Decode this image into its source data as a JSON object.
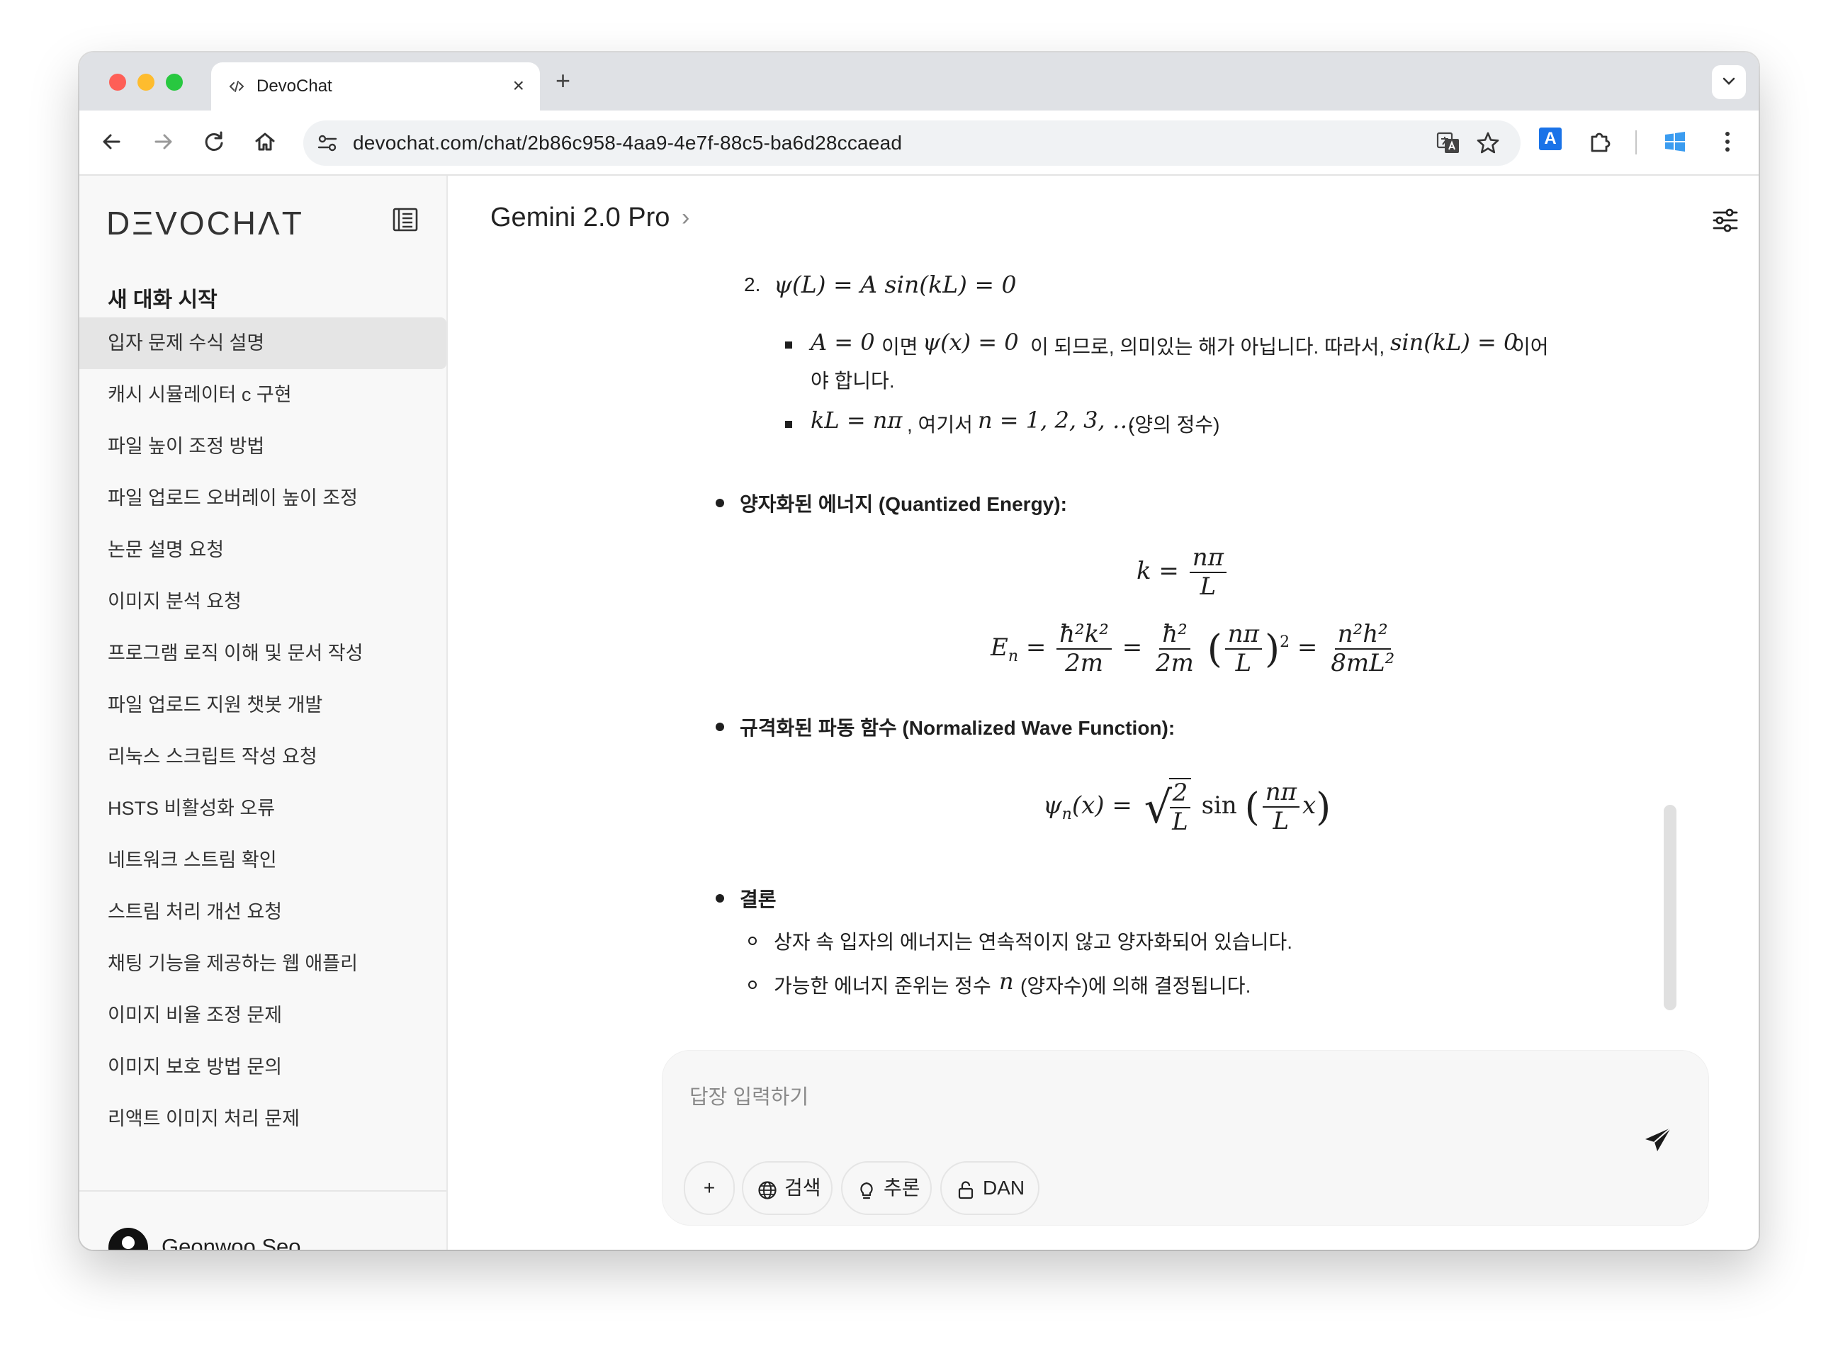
{
  "browser": {
    "tab_title": "DevoChat",
    "new_tab_label": "+",
    "url": "devochat.com/chat/2b86c958-4aa9-4e7f-88c5-ba6d28ccaead",
    "extension_a_label": "A"
  },
  "sidebar": {
    "logo": "DΞVOCHΛT",
    "new_chat_label": "새 대화 시작",
    "chats": [
      {
        "label": "입자 문제 수식 설명",
        "active": true
      },
      {
        "label": "캐시 시뮬레이터 c 구현"
      },
      {
        "label": "파일 높이 조정 방법"
      },
      {
        "label": "파일 업로드 오버레이 높이 조정"
      },
      {
        "label": "논문 설명 요청"
      },
      {
        "label": "이미지 분석 요청"
      },
      {
        "label": "프로그램 로직 이해 및 문서 작성"
      },
      {
        "label": "파일 업로드 지원 챗봇 개발"
      },
      {
        "label": "리눅스 스크립트 작성 요청"
      },
      {
        "label": "HSTS 비활성화 오류"
      },
      {
        "label": "네트워크 스트림 확인"
      },
      {
        "label": "스트림 처리 개선 요청"
      },
      {
        "label": "채팅 기능을 제공하는 웹 애플리"
      },
      {
        "label": "이미지 비율 조정 문제"
      },
      {
        "label": "이미지 보호 방법 문의"
      },
      {
        "label": "리액트 이미지 처리 문제"
      }
    ],
    "user_name": "Geonwoo Seo"
  },
  "header": {
    "model_name": "Gemini 2.0 Pro",
    "chevron": "›"
  },
  "message": {
    "item2_number": "2.",
    "item2_eq": "ψ(L) = A sin(kL) = 0",
    "sub1_eq1": "A = 0",
    "sub1_t1": "이면",
    "sub1_eq2": "ψ(x) = 0",
    "sub1_t2": "이 되므로, 의미있는 해가 아닙니다. 따라서,",
    "sub1_eq3": "sin(kL) = 0",
    "sub1_t3": "이어",
    "sub1_line2": "야 합니다.",
    "sub2_eq": "kL = nπ",
    "sub2_t1": ", 여기서",
    "sub2_eq2": "n = 1, 2, 3, …",
    "sub2_t2": "(양의 정수)",
    "heading_energy": "양자화된 에너지 (Quantized Energy):",
    "heading_wave": "규격화된 파동 함수 (Normalized Wave Function):",
    "heading_conclusion": "결론",
    "conclusion_1": "상자 속 입자의 에너지는 연속적이지 않고 양자화되어 있습니다.",
    "conclusion_2a": "가능한 에너지 준위는 정수",
    "conclusion_2_var": "n",
    "conclusion_2b": "(양자수)에 의해 결정됩니다.",
    "eq_k": {
      "lhs": "k =",
      "num": "nπ",
      "den": "L"
    },
    "eq_E": {
      "lhs": "E",
      "lhs_sub": "n",
      "eq": "=",
      "f1_num": "ħ²k²",
      "f1_den": "2m",
      "f2_num": "ħ²",
      "f2_den": "2m",
      "f3_num": "nπ",
      "f3_den": "L",
      "exp": "2",
      "f4_num": "n²h²",
      "f4_den": "8mL²"
    },
    "eq_psi": {
      "lhs": "ψ",
      "lhs_sub": "n",
      "lhs_arg": "(x) =",
      "rt_num": "2",
      "rt_den": "L",
      "sin": "sin",
      "arg_num": "nπ",
      "arg_den": "L",
      "arg_x": "x"
    }
  },
  "composer": {
    "placeholder": "답장 입력하기",
    "plus_label": "+",
    "search_label": "검색",
    "reason_label": "추론",
    "dan_label": "DAN"
  }
}
